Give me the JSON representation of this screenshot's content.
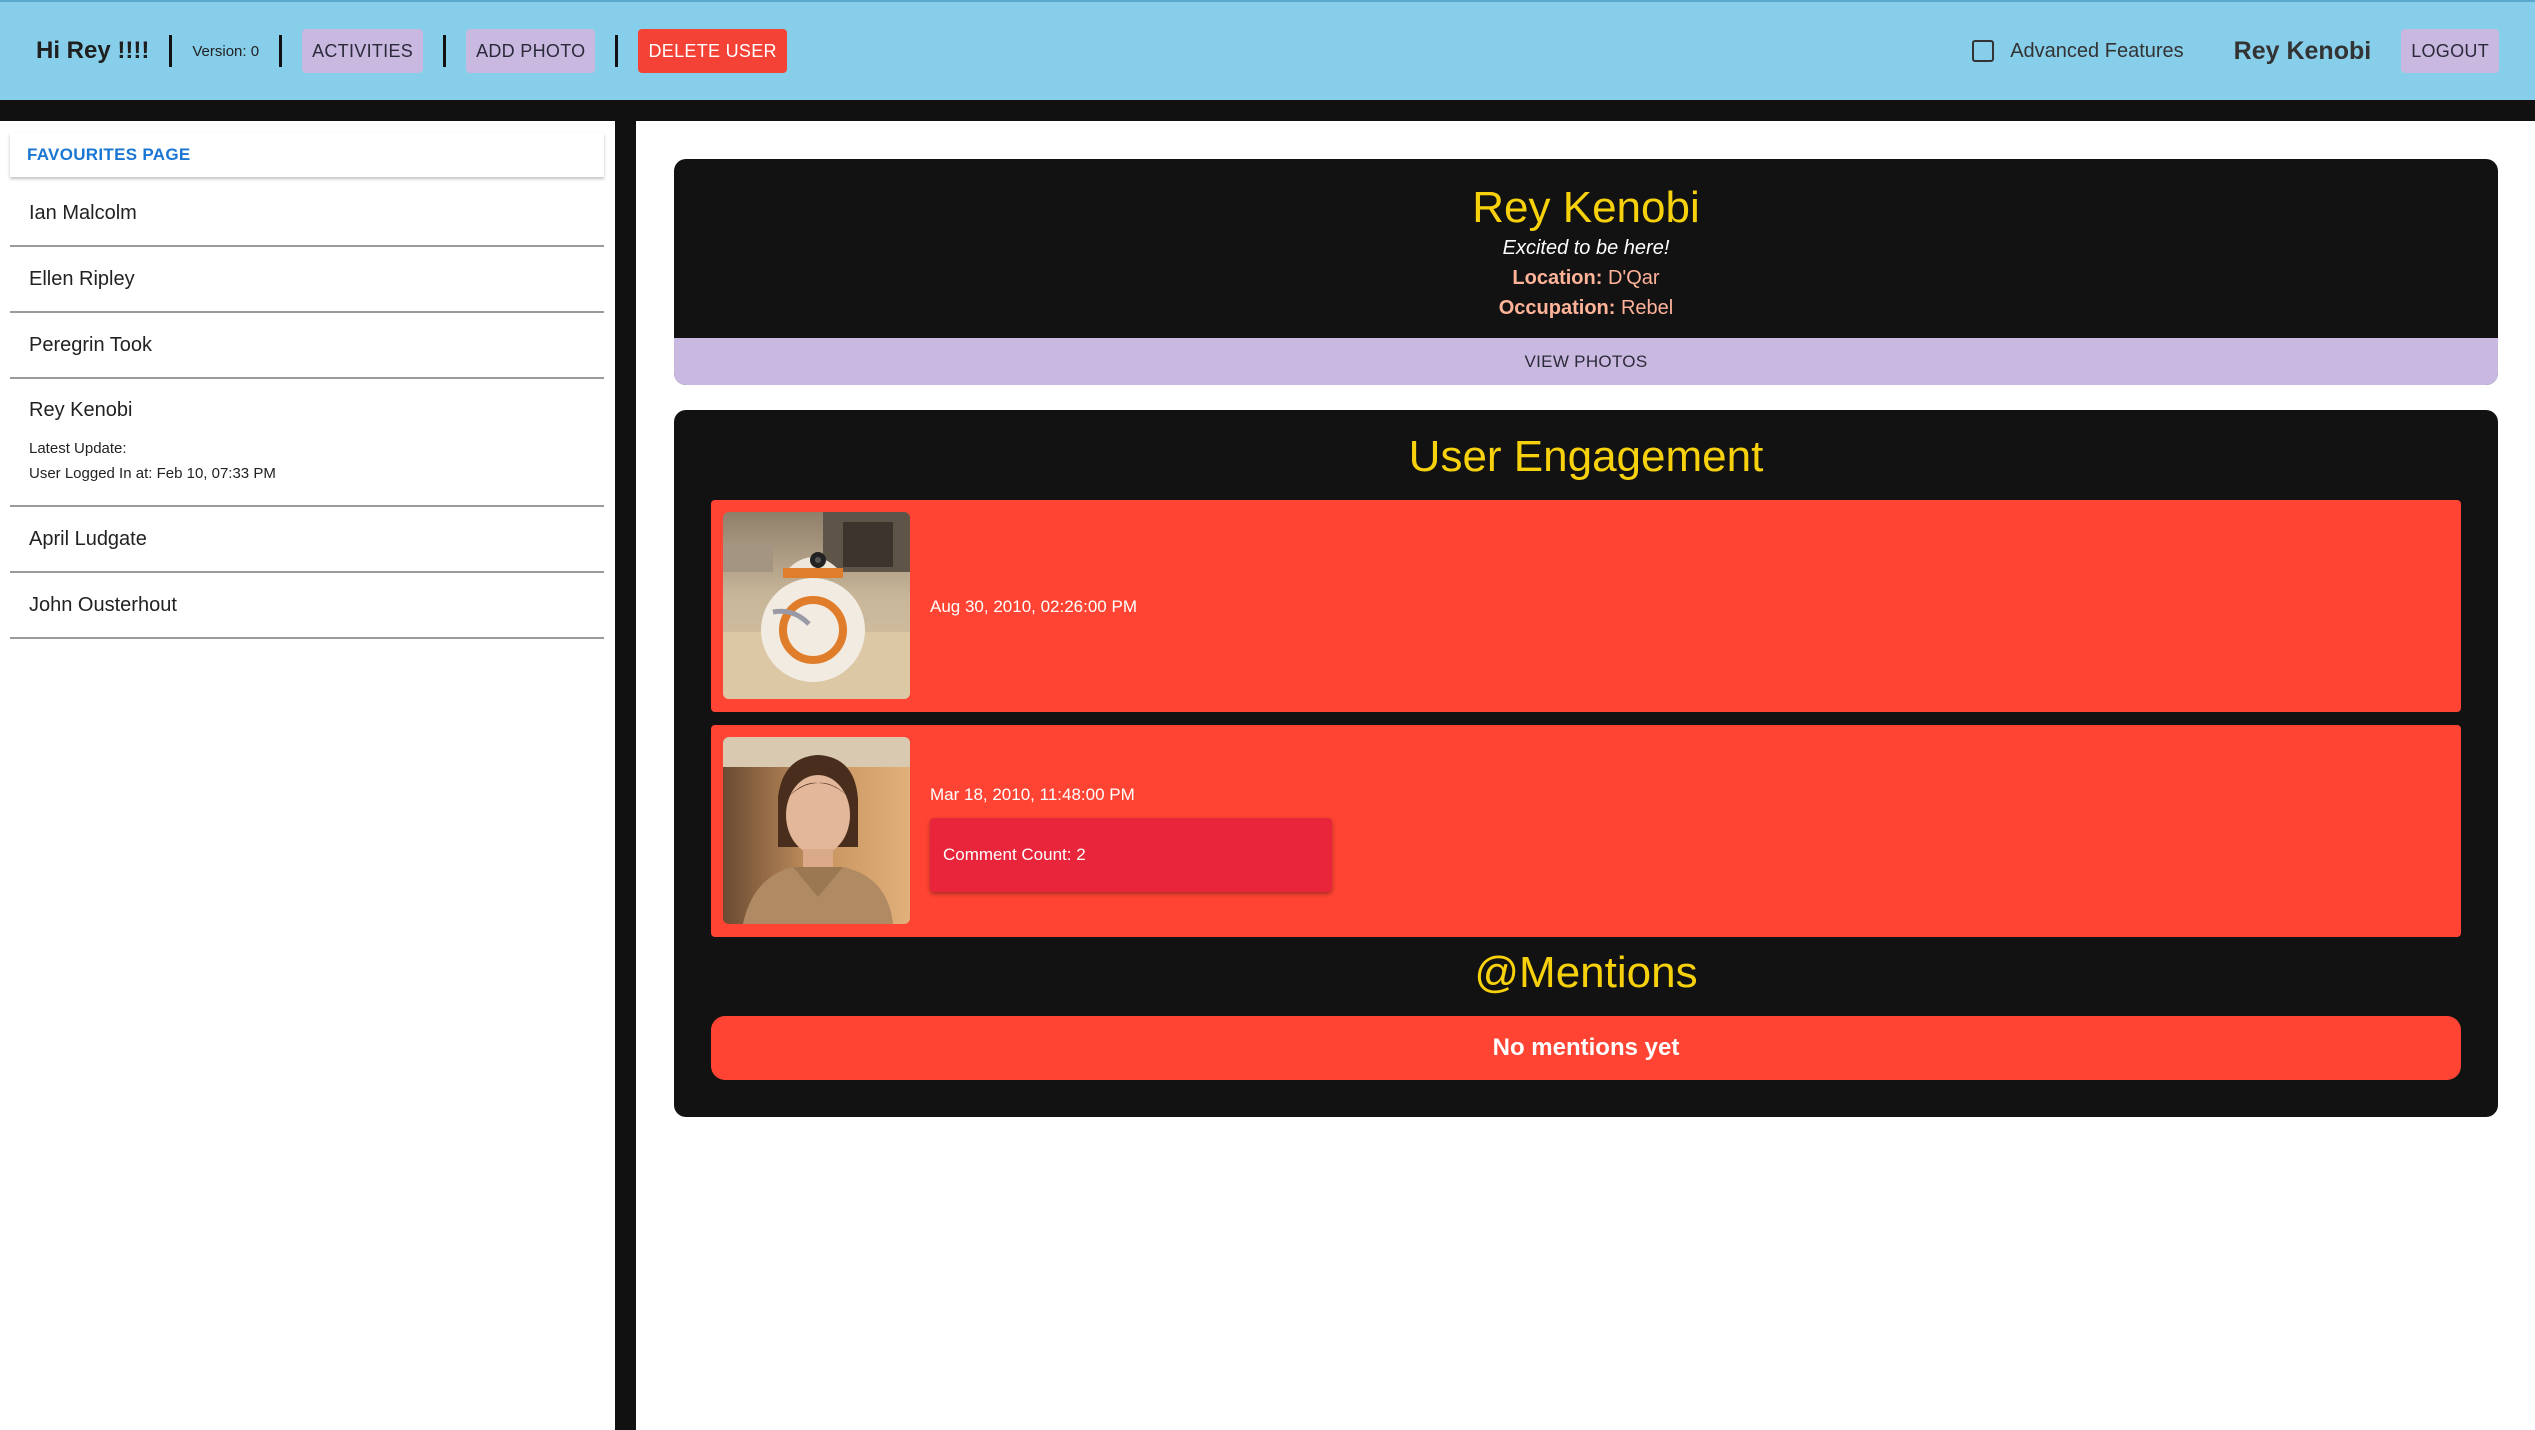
{
  "appbar": {
    "greeting": "Hi Rey !!!!",
    "version": "Version: 0",
    "activities_label": "ACTIVITIES",
    "add_photo_label": "ADD PHOTO",
    "delete_user_label": "DELETE USER",
    "advanced_label": "Advanced Features",
    "advanced_checked": false,
    "user_name": "Rey Kenobi",
    "logout_label": "LOGOUT"
  },
  "sidebar": {
    "tab_label": "FAVOURITES PAGE",
    "users": [
      {
        "name": "Ian Malcolm"
      },
      {
        "name": "Ellen Ripley"
      },
      {
        "name": "Peregrin Took"
      },
      {
        "name": "Rey Kenobi",
        "latest_update_label": "Latest Update:",
        "latest_update": "User Logged In at: Feb 10, 07:33 PM"
      },
      {
        "name": "April Ludgate"
      },
      {
        "name": "John Ousterhout"
      }
    ]
  },
  "profile": {
    "name": "Rey Kenobi",
    "status": "Excited to be here!",
    "location_label": "Location:",
    "location": "D'Qar",
    "occupation_label": "Occupation:",
    "occupation": "Rebel",
    "view_photos_label": "VIEW PHOTOS"
  },
  "engagement": {
    "title": "User Engagement",
    "activities": [
      {
        "date": "Aug 30, 2010, 02:26:00 PM",
        "thumbnail": "bb8-photo"
      },
      {
        "date": "Mar 18, 2010, 11:48:00 PM",
        "thumbnail": "rey-portrait-photo",
        "comment_count": "Comment Count: 2"
      }
    ],
    "mentions_title": "@Mentions",
    "mentions_empty": "No mentions yet"
  },
  "colors": {
    "appbar": "#87ceeb",
    "accent_yellow": "#f7d10b",
    "activity_red": "#ff4433",
    "lavender": "#c9b8df",
    "danger": "#f44336"
  }
}
